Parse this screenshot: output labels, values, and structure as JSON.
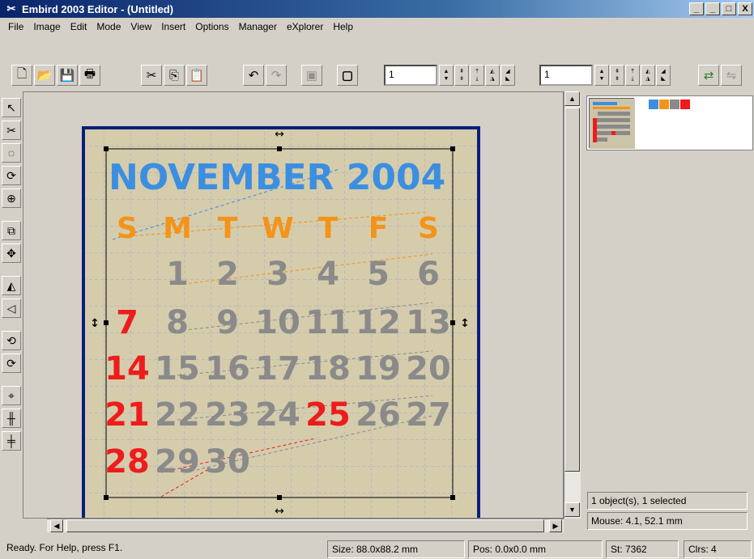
{
  "window": {
    "title": "Embird 2003 Editor - (Untitled)",
    "minimize_label": "_",
    "restore_label": "_",
    "maximize_label": "□",
    "close_label": "X"
  },
  "menu": [
    "File",
    "Image",
    "Edit",
    "Mode",
    "View",
    "Insert",
    "Options",
    "Manager",
    "eXplorer",
    "Help"
  ],
  "toolbar": {
    "field1_value": "1",
    "field2_value": "1"
  },
  "design": {
    "title": "NOVEMBER 2004",
    "weekdays": [
      "S",
      "M",
      "T",
      "W",
      "T",
      "F",
      "S"
    ],
    "weeks": [
      [
        "",
        "1",
        "2",
        "3",
        "4",
        "5",
        "6"
      ],
      [
        "7",
        "8",
        "9",
        "10",
        "11",
        "12",
        "13"
      ],
      [
        "14",
        "15",
        "16",
        "17",
        "18",
        "19",
        "20"
      ],
      [
        "21",
        "22",
        "23",
        "24",
        "25",
        "26",
        "27"
      ],
      [
        "28",
        "29",
        "30",
        "",
        "",
        "",
        ""
      ]
    ],
    "colors": {
      "title": "#3c8fe0",
      "weekday": "#f39419",
      "day": "#8a8a8a",
      "sunday": "#ee1c1c",
      "holiday": "#ee1c1c",
      "hoop": "#0b1f7a",
      "fabric": "#d5ccac"
    }
  },
  "right_panel": {
    "swatch_colors": [
      "#3c8fe0",
      "#f39419",
      "#8a8a8a",
      "#ee1c1c"
    ],
    "selection_info": "1 object(s), 1 selected",
    "mouse_info": "Mouse: 4.1, 52.1 mm"
  },
  "status": {
    "help": "Ready. For Help, press F1.",
    "size": "Size: 88.0x88.2 mm",
    "pos": "Pos: 0.0x0.0 mm",
    "stitches": "St: 7362",
    "colors": "Clrs: 4"
  }
}
